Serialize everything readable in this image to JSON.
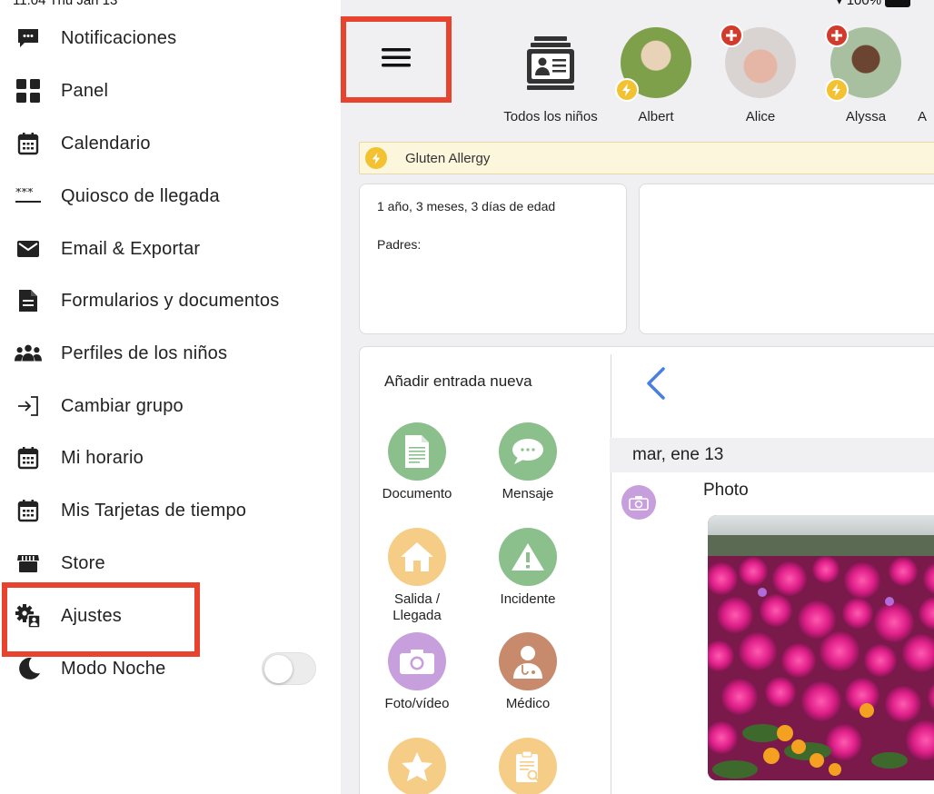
{
  "status_bar": {
    "time_date": "11:04  Thu Jan 13",
    "battery": "100%"
  },
  "sidebar": {
    "items": [
      {
        "label": "Notificaciones",
        "icon": "chat-bubble-icon"
      },
      {
        "label": "Panel",
        "icon": "dashboard-grid-icon"
      },
      {
        "label": "Calendario",
        "icon": "calendar-icon"
      },
      {
        "label": "Quiosco de llegada",
        "icon": "pin-dots-icon"
      },
      {
        "label": "Email & Exportar",
        "icon": "envelope-icon"
      },
      {
        "label": "Formularios y documentos",
        "icon": "document-icon"
      },
      {
        "label": "Perfiles de los niños",
        "icon": "group-icon"
      },
      {
        "label": "Cambiar grupo",
        "icon": "switch-group-icon"
      },
      {
        "label": "Mi horario",
        "icon": "calendar-icon"
      },
      {
        "label": "Mis Tarjetas de tiempo",
        "icon": "calendar-icon"
      },
      {
        "label": "Store",
        "icon": "store-icon"
      },
      {
        "label": "Ajustes",
        "icon": "settings-gear-icon"
      },
      {
        "label": "Modo Noche",
        "icon": "moon-icon"
      }
    ],
    "night_mode_on": false
  },
  "children_bar": {
    "all_label": "Todos los niños",
    "children": [
      {
        "name": "Albert",
        "medical": false,
        "allergy": true
      },
      {
        "name": "Alice",
        "medical": true,
        "allergy": false
      },
      {
        "name": "Alyssa",
        "medical": true,
        "allergy": true
      },
      {
        "name": "A",
        "medical": false,
        "allergy": false
      }
    ]
  },
  "allergy": {
    "text": "Gluten Allergy"
  },
  "child_info": {
    "age": "1 año, 3 meses, 3 días de edad",
    "parents_label": "Padres:"
  },
  "entries": {
    "title": "Añadir entrada nueva",
    "buttons": [
      {
        "label": "Documento",
        "icon": "document-icon",
        "color": "#8bbf8c"
      },
      {
        "label": "Mensaje",
        "icon": "message-icon",
        "color": "#8bbf8c"
      },
      {
        "label": "Salida / Llegada",
        "icon": "house-icon",
        "color": "#f5cd86"
      },
      {
        "label": "Incidente",
        "icon": "warning-icon",
        "color": "#8bbf8c"
      },
      {
        "label": "Foto/vídeo",
        "icon": "camera-icon",
        "color": "#c79fdc"
      },
      {
        "label": "Médico",
        "icon": "doctor-icon",
        "color": "#c78a6c"
      },
      {
        "label": "",
        "icon": "star-icon",
        "color": "#f5cd86"
      },
      {
        "label": "",
        "icon": "clipboard-search-icon",
        "color": "#f5cd86"
      }
    ]
  },
  "feed": {
    "date": "mar, ene 13",
    "entry_title": "Photo"
  },
  "colors": {
    "highlight": "#e8432f",
    "back_arrow": "#4a7ee3",
    "allergy_bg": "#fcf6dc"
  }
}
